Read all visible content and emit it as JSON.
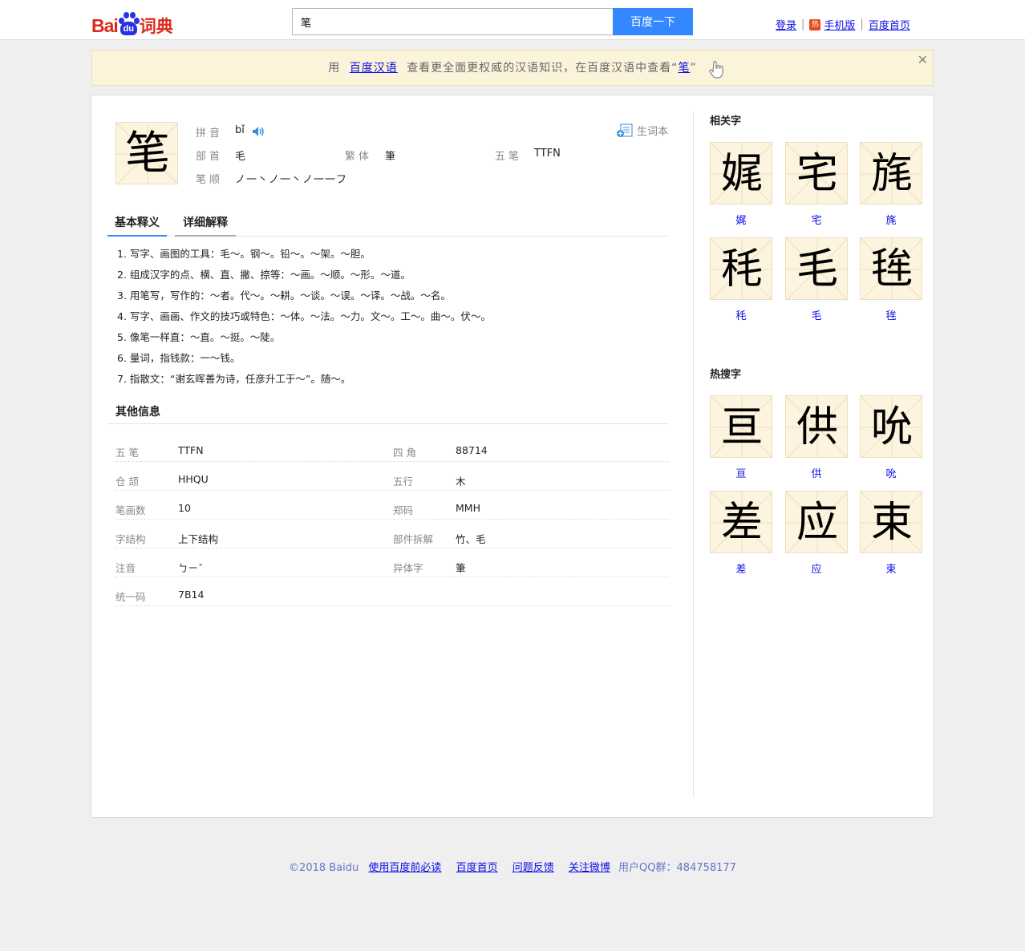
{
  "header": {
    "logo_text_bai": "Bai",
    "logo_text_du": "du",
    "logo_text_cidian": "词典",
    "search_value": "笔",
    "search_button": "百度一下",
    "login": "登录",
    "hot_badge": "热",
    "mobile": "手机版",
    "baidu_home": "百度首页"
  },
  "notice": {
    "prefix": "用",
    "link1": "百度汉语",
    "middle": "查看更全面更权威的汉语知识，在百度汉语中查看“",
    "link2": "笔",
    "suffix": "”",
    "close": "✕"
  },
  "entry": {
    "character": "笔",
    "pinyin_label": "拼音",
    "pinyin": "bǐ",
    "radical_label": "部首",
    "radical": "毛",
    "traditional_label": "繁体",
    "traditional": "筆",
    "wubi_label": "五笔",
    "wubi": "TTFN",
    "stroke_order_label": "笔顺",
    "stroke_order": "ノ一丶ノ一丶ノ一一フ",
    "vocab_button": "生词本"
  },
  "tabs": [
    {
      "label": "基本释义"
    },
    {
      "label": "详细解释"
    }
  ],
  "definitions": [
    "1. 写字、画图的工具：毛～。钢～。铅～。～架。～胆。",
    "2. 组成汉字的点、横、直、撇、捺等：～画。～顺。～形。～道。",
    "3. 用笔写，写作的：～者。代～。～耕。～谈。～误。～译。～战。～名。",
    "4. 写字、画画、作文的技巧或特色：～体。～法。～力。文～。工～。曲～。伏～。",
    "5. 像笔一样直：～直。～挺。～陡。",
    "6. 量词，指钱款：一～钱。",
    "7. 指散文：“谢玄晖善为诗，任彦升工于～”。随～。"
  ],
  "other_info": {
    "title": "其他信息",
    "rows": [
      {
        "k1": "五 笔",
        "v1": "TTFN",
        "k2": "四 角",
        "v2": "88714"
      },
      {
        "k1": "仓 颉",
        "v1": "HHQU",
        "k2": "五行",
        "v2": "木"
      },
      {
        "k1": "笔画数",
        "v1": "10",
        "k2": "郑码",
        "v2": "MMH"
      },
      {
        "k1": "字结构",
        "v1": "上下结构",
        "k2": "部件拆解",
        "v2": "竹、毛"
      },
      {
        "k1": "注音",
        "v1": "ㄅㄧˇ",
        "k2": "异体字",
        "v2": "筆"
      },
      {
        "k1": "统一码",
        "v1": "7B14",
        "k2": "",
        "v2": ""
      }
    ]
  },
  "related": {
    "title": "相关字",
    "chars": [
      "娓",
      "宅",
      "旄",
      "秏",
      "毛",
      "毪"
    ]
  },
  "hot": {
    "title": "热搜字",
    "chars": [
      "亘",
      "供",
      "吮",
      "差",
      "应",
      "束"
    ]
  },
  "footer": {
    "copyright": "©2018 Baidu",
    "link1": "使用百度前必读",
    "link2": "百度首页",
    "link3": "问题反馈",
    "link4": "关注微博",
    "qq": "用户QQ群：484758177"
  }
}
